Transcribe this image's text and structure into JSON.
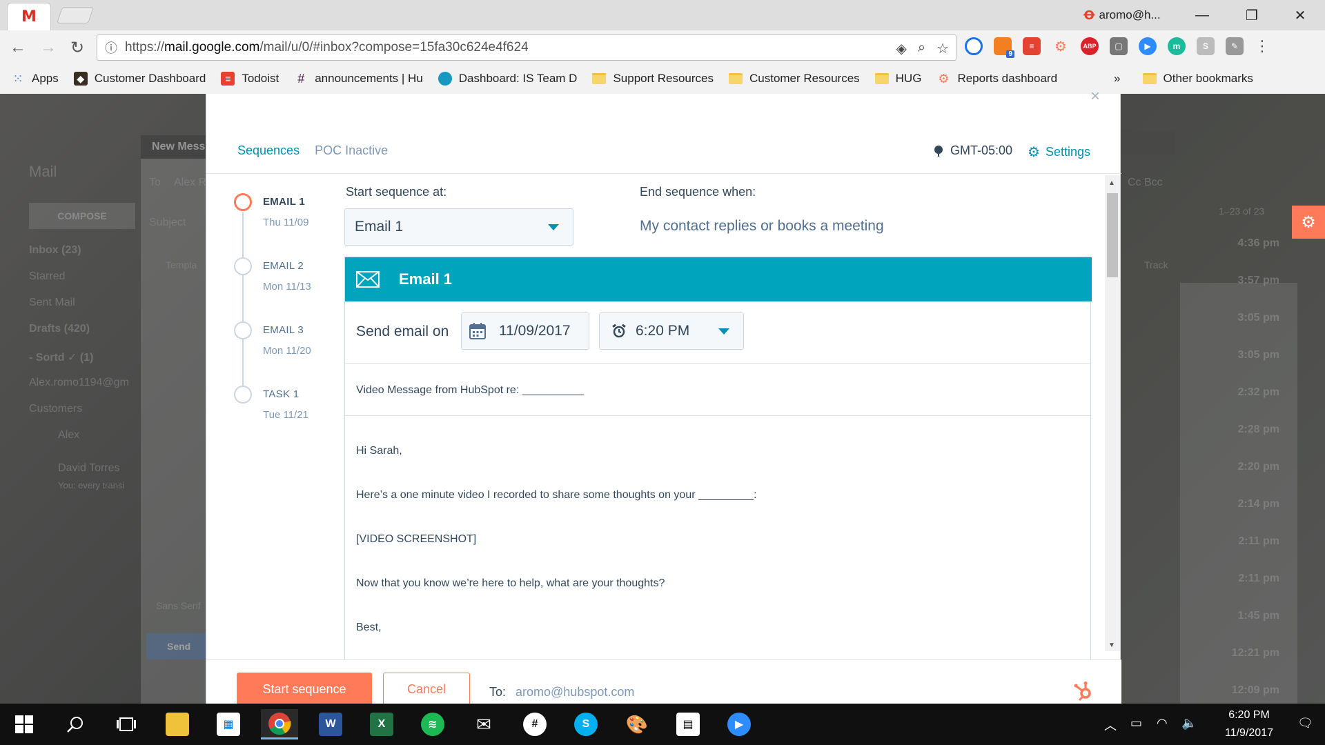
{
  "browser": {
    "url_prefix": "https://",
    "url_host": "mail.google.com",
    "url_path": "/mail/u/0/#inbox?compose=15fa30c624e4f624",
    "profile_name": "aromo@h...",
    "bookmarks": [
      {
        "label": "Apps",
        "icon": "apps-grid-icon",
        "color": "#4285f4"
      },
      {
        "label": "Customer Dashboard",
        "icon": "dashboard-icon",
        "color": "#3a2e24"
      },
      {
        "label": "Todoist",
        "icon": "todoist-icon",
        "color": "#e44332"
      },
      {
        "label": "announcements | Hu",
        "icon": "slack-icon",
        "color": "#4a154b"
      },
      {
        "label": "Dashboard: IS Team D",
        "icon": "salesforce-cloud-icon",
        "color": "#1798c1"
      },
      {
        "label": "Support Resources",
        "icon": "folder-icon",
        "color": "#f6d66b"
      },
      {
        "label": "Customer Resources",
        "icon": "folder-icon",
        "color": "#f6d66b"
      },
      {
        "label": "HUG",
        "icon": "folder-icon",
        "color": "#f6d66b"
      },
      {
        "label": "Reports dashboard",
        "icon": "hubspot-sprocket-icon",
        "color": "#ff7a59"
      }
    ],
    "overflow": "»",
    "other_bookmarks": "Other bookmarks",
    "extension_badge": "9"
  },
  "gmail_bg": {
    "mail": "Mail",
    "compose": "COMPOSE",
    "inbox": "Inbox (23)",
    "starred": "Starred",
    "sent": "Sent Mail",
    "drafts": "Drafts (420)",
    "sortd": "- Sortd ✓ (1)",
    "account": "Alex.romo1194@gm",
    "customers": "Customers",
    "user": "Alex",
    "contact_name": "David Torres",
    "contact_snippet": "You: every transi",
    "new_message": "New Mess",
    "to_label": "To",
    "to_value": "Alex R",
    "subject": "Subject",
    "templates": "Templa",
    "font": "Sans Serif",
    "send": "Send",
    "cc_bcc": "Cc Bcc",
    "track": "Track",
    "range": "1–23 of 23",
    "times": [
      "4:36 pm",
      "3:57 pm",
      "3:05 pm",
      "3:05 pm",
      "2:32 pm",
      "2:28 pm",
      "2:20 pm",
      "2:14 pm",
      "2:11 pm",
      "2:11 pm",
      "1:45 pm",
      "12:21 pm",
      "12:09 pm"
    ]
  },
  "modal": {
    "tabs": [
      {
        "label": "Sequences",
        "active": true
      },
      {
        "label": "POC Inactive",
        "active": false
      }
    ],
    "timezone": "GMT-05:00",
    "settings_label": "Settings",
    "steps": [
      {
        "name": "EMAIL 1",
        "date": "Thu 11/09",
        "active": true
      },
      {
        "name": "EMAIL 2",
        "date": "Mon 11/13",
        "active": false
      },
      {
        "name": "EMAIL 3",
        "date": "Mon 11/20",
        "active": false
      },
      {
        "name": "TASK 1",
        "date": "Tue 11/21",
        "active": false
      }
    ],
    "start_label": "Start sequence at:",
    "start_value": "Email 1",
    "end_label": "End sequence when:",
    "end_value": "My contact replies or books a meeting",
    "card_title": "Email 1",
    "send_label": "Send email on",
    "send_date": "11/09/2017",
    "send_time": "6:20 PM",
    "subject": "Video Message from HubSpot re: __________",
    "body": [
      "Hi Sarah,",
      "Here’s a one minute video I recorded to share some thoughts on your _________:",
      "[VIDEO SCREENSHOT]",
      "Now that you know we’re here to help, what are your thoughts?",
      "Best,"
    ],
    "start_button": "Start sequence",
    "cancel_button": "Cancel",
    "to_label": "To:",
    "to_value": "aromo@hubspot.com",
    "close": "×"
  },
  "taskbar": {
    "time": "6:20 PM",
    "date": "11/9/2017"
  },
  "colors": {
    "accent_teal": "#00a4bd",
    "hubspot_orange": "#ff7a59",
    "link_blue": "#0091ae"
  }
}
